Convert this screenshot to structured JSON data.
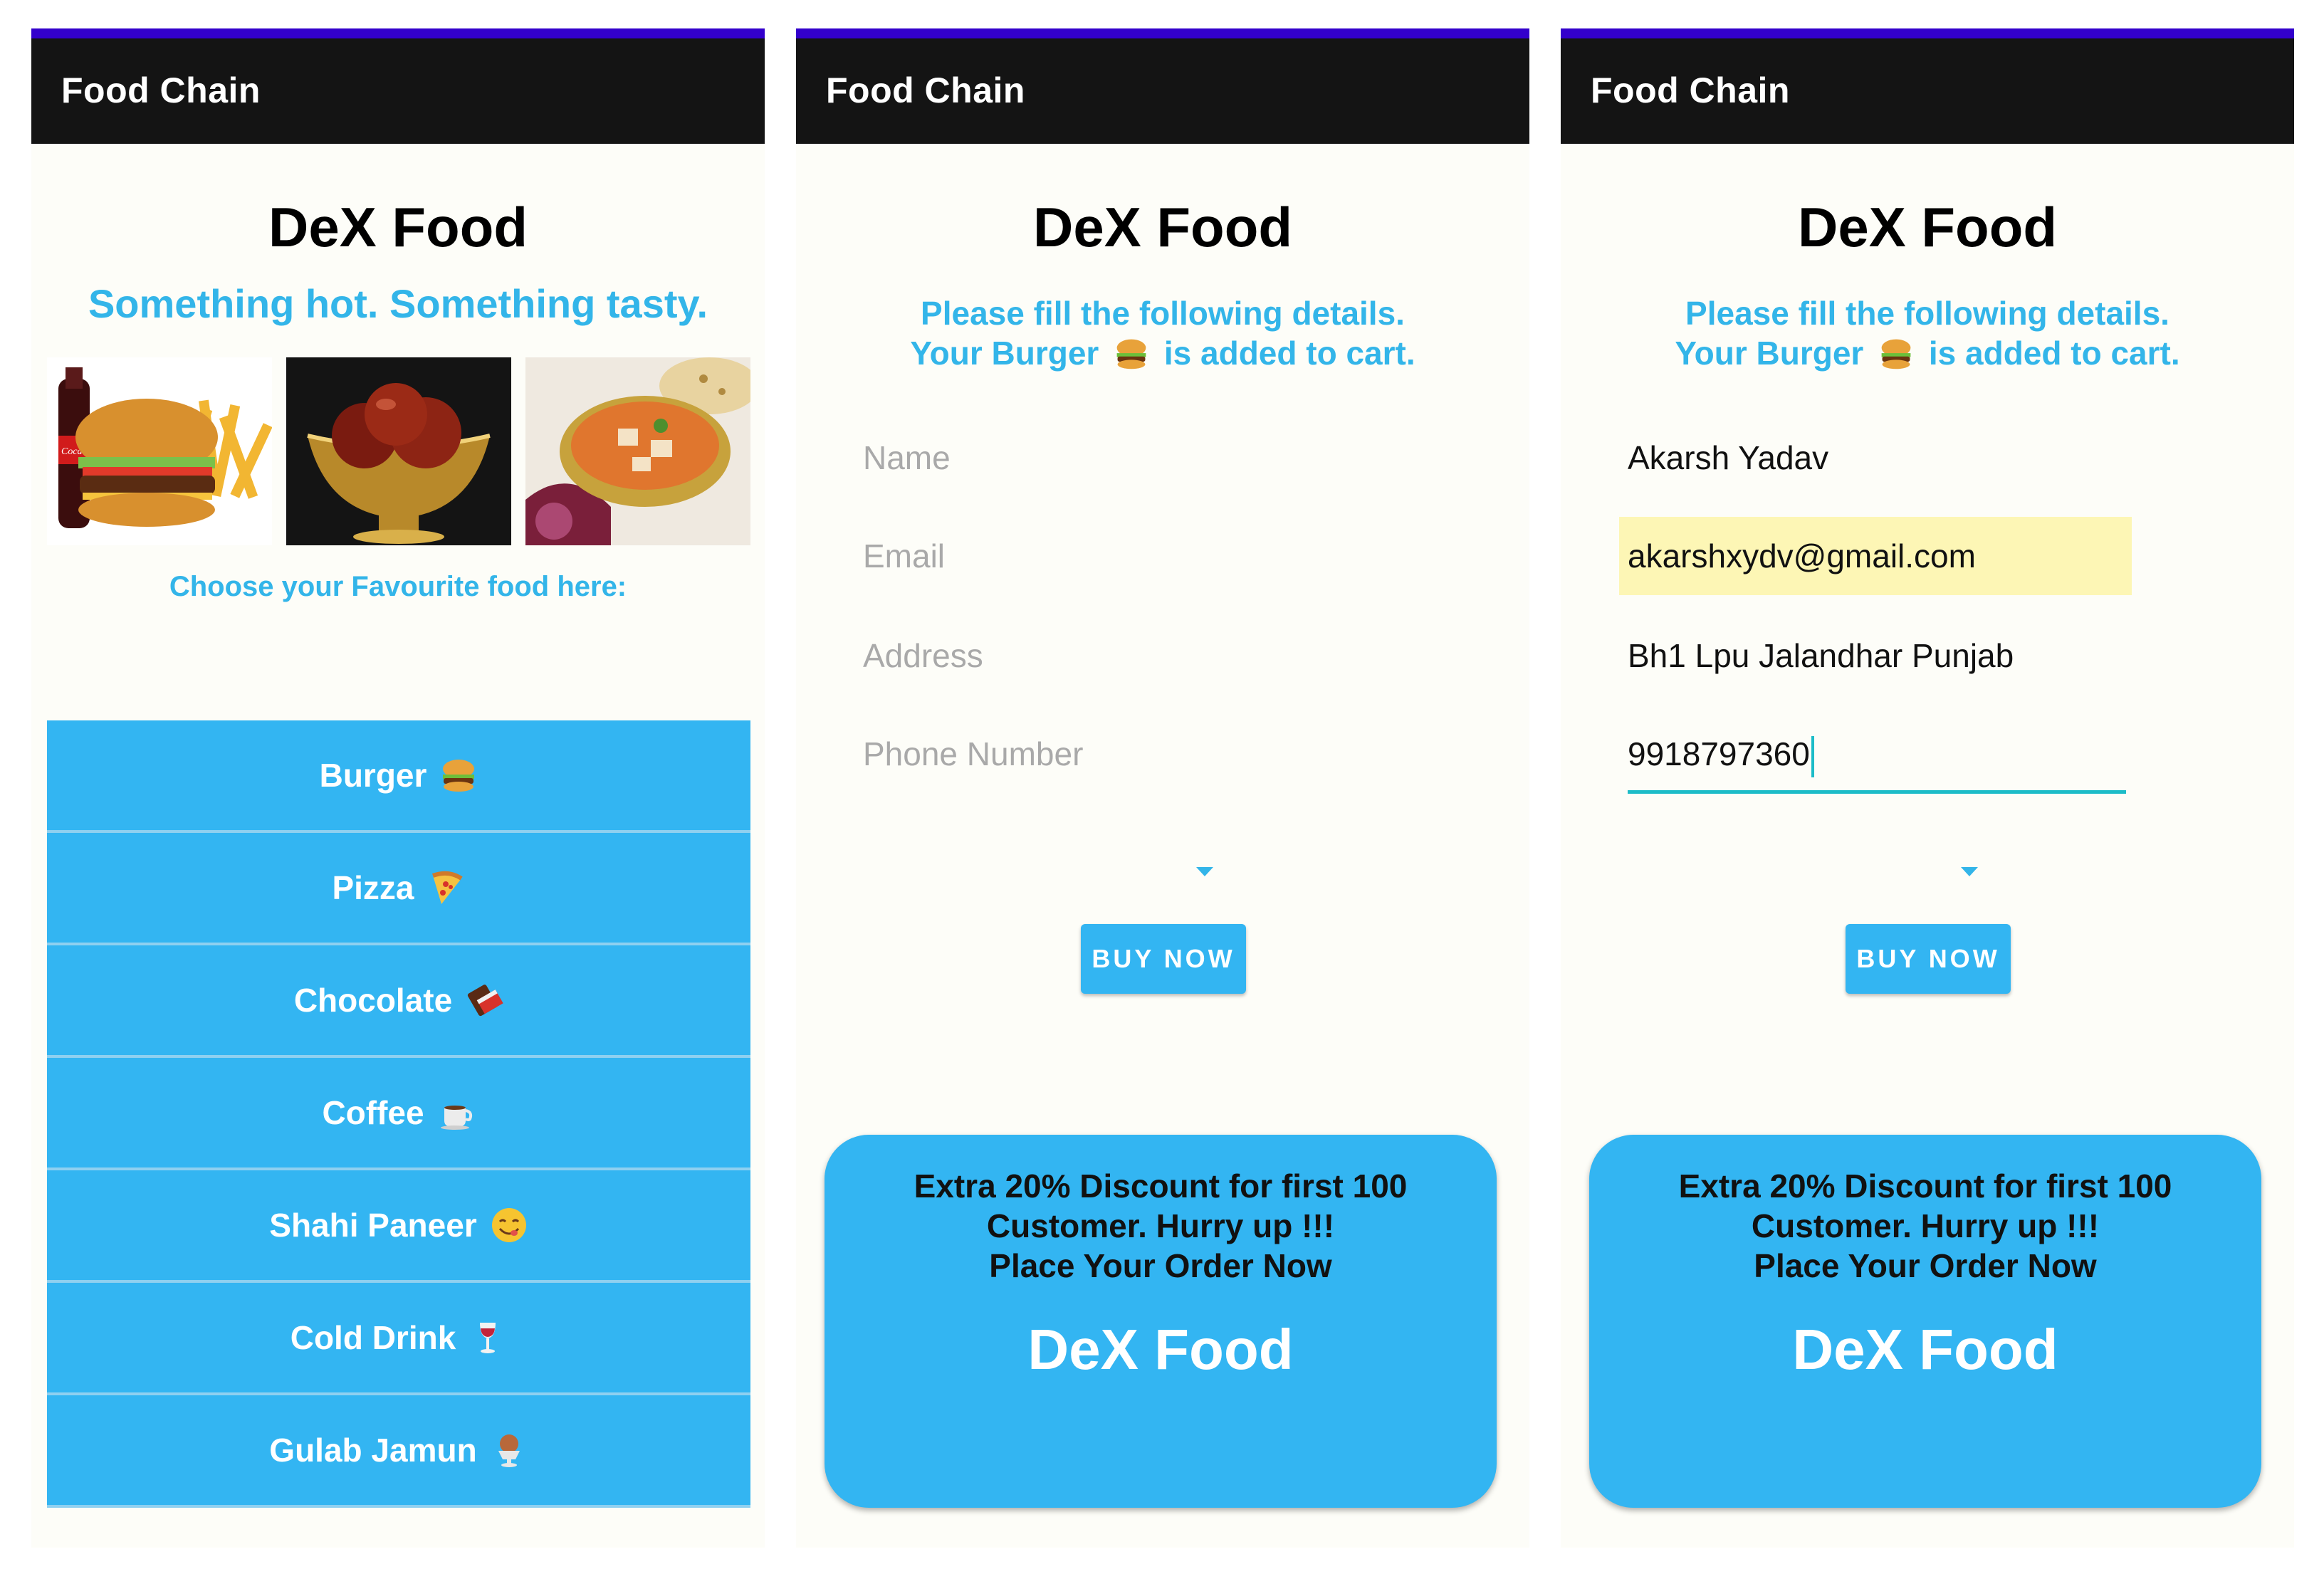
{
  "screens": [
    {
      "app_title": "Food Chain",
      "brand": "DeX Food",
      "tagline": "Something hot. Something tasty.",
      "images": [
        "burger-combo",
        "gulab-jamun-bowl",
        "shahi-paneer-dish"
      ],
      "choose_label": "Choose your Favourite food here:",
      "menu": [
        {
          "label": "Burger",
          "icon": "burger-icon"
        },
        {
          "label": "Pizza",
          "icon": "pizza-icon"
        },
        {
          "label": "Chocolate",
          "icon": "chocolate-icon"
        },
        {
          "label": "Coffee",
          "icon": "coffee-icon"
        },
        {
          "label": "Shahi Paneer",
          "icon": "yum-face-icon"
        },
        {
          "label": "Cold Drink",
          "icon": "wine-glass-icon"
        },
        {
          "label": "Gulab Jamun",
          "icon": "dessert-icon"
        }
      ]
    },
    {
      "app_title": "Food Chain",
      "brand": "DeX Food",
      "subhead_line1": "Please fill the following details.",
      "subhead_line2_a": "Your Burger",
      "subhead_line2_b": "is added to cart.",
      "fields": {
        "name": {
          "placeholder": "Name",
          "value": ""
        },
        "email": {
          "placeholder": "Email",
          "value": ""
        },
        "address": {
          "placeholder": "Address",
          "value": ""
        },
        "phone": {
          "placeholder": "Phone Number",
          "value": ""
        }
      },
      "buy_label": "BUY NOW",
      "promo": {
        "line1": "Extra 20% Discount for first 100",
        "line2": "Customer. Hurry up !!!",
        "line3": "Place Your Order Now",
        "brand": "DeX Food"
      }
    },
    {
      "app_title": "Food Chain",
      "brand": "DeX Food",
      "subhead_line1": "Please fill the following details.",
      "subhead_line2_a": "Your Burger",
      "subhead_line2_b": "is added to cart.",
      "fields": {
        "name": {
          "placeholder": "Name",
          "value": "Akarsh Yadav"
        },
        "email": {
          "placeholder": "Email",
          "value": "akarshxydv@gmail.com"
        },
        "address": {
          "placeholder": "Address",
          "value": "Bh1 Lpu Jalandhar Punjab"
        },
        "phone": {
          "placeholder": "Phone Number",
          "value": "9918797360"
        }
      },
      "buy_label": "BUY NOW",
      "promo": {
        "line1": "Extra 20% Discount for first 100",
        "line2": "Customer. Hurry up !!!",
        "line3": "Place Your Order Now",
        "brand": "DeX Food"
      }
    }
  ],
  "colors": {
    "accent": "#33b5f2",
    "accent_text": "#33b5e9",
    "appbar": "#141414",
    "status_bar": "#3300cc",
    "highlight": "#fdf6b5",
    "focus_line": "#1cbcc8"
  }
}
